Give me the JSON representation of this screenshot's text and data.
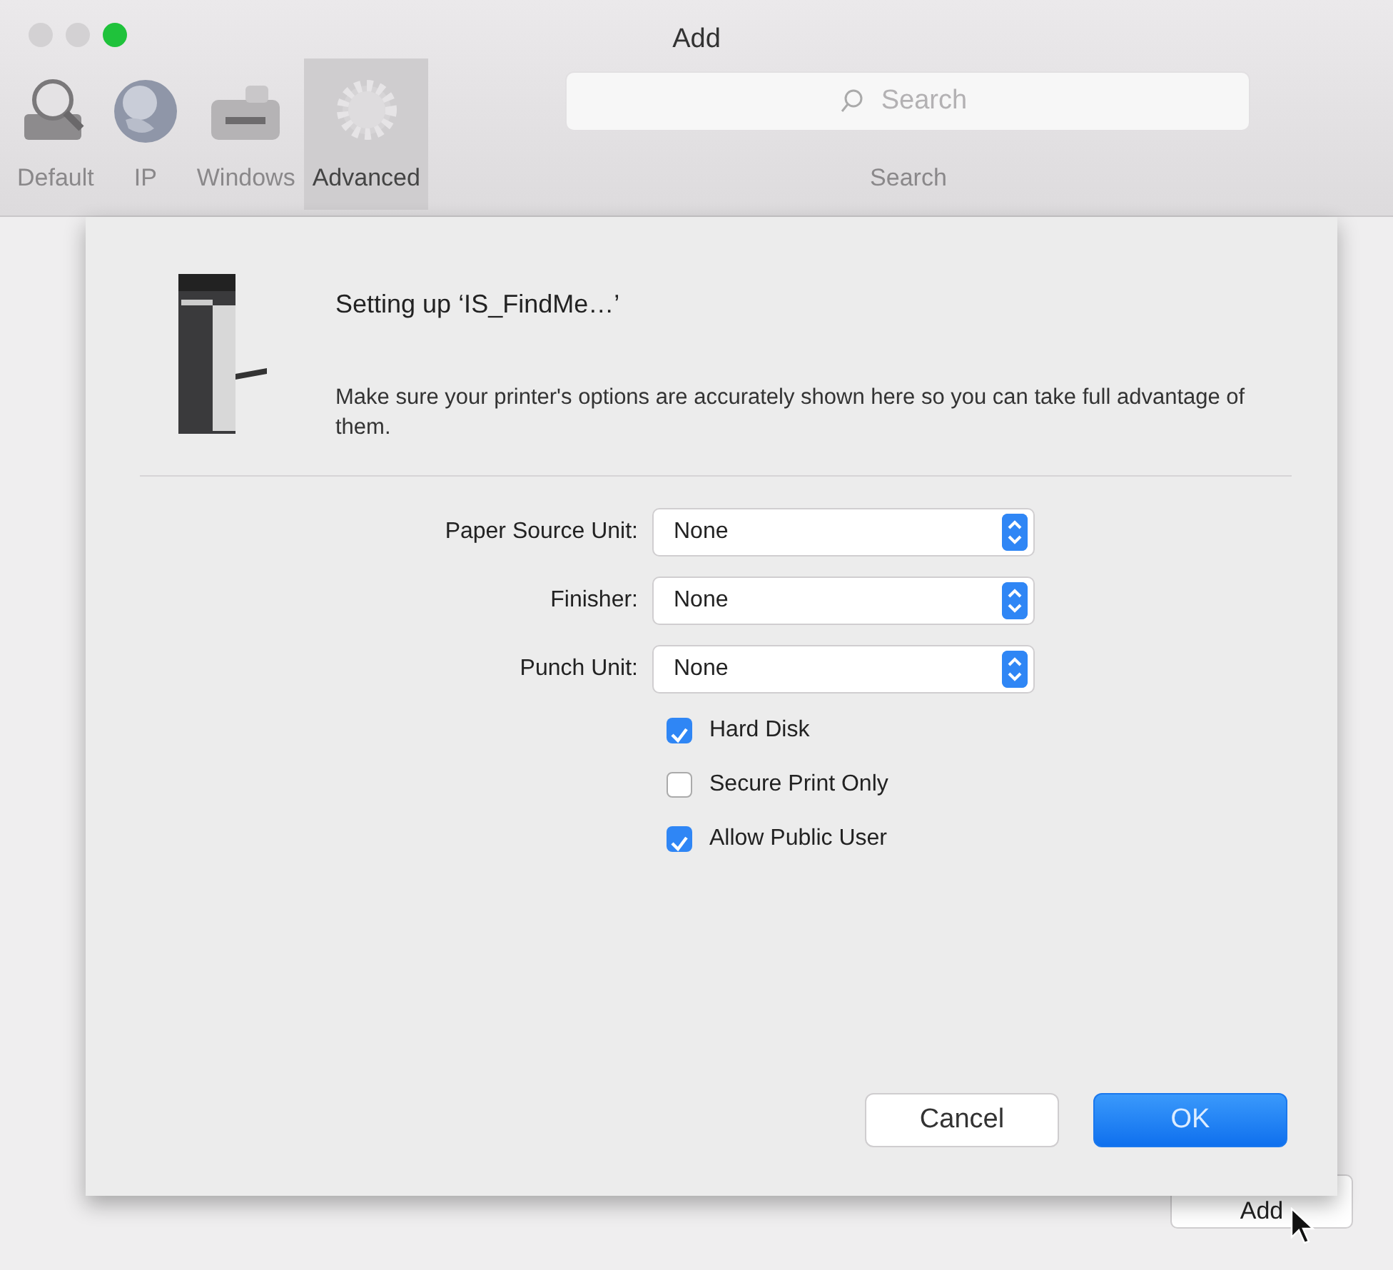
{
  "window": {
    "title": "Add",
    "controls": [
      {
        "color": "#d3d1d3"
      },
      {
        "color": "#d3d1d3"
      },
      {
        "color": "#1fc23b"
      }
    ]
  },
  "toolbar": [
    {
      "label": "Default",
      "kind": "default",
      "selected": false
    },
    {
      "label": "IP",
      "kind": "ip",
      "selected": false
    },
    {
      "label": "Windows",
      "kind": "windows",
      "selected": false
    },
    {
      "label": "Advanced",
      "kind": "advanced",
      "selected": true
    }
  ],
  "search": {
    "placeholder": "Search",
    "label": "Search"
  },
  "sheet": {
    "title": "Setting up ‘IS_FindMe…’",
    "description": "Make sure your printer's options are accurately shown here so you can take full advantage of them.",
    "options": [
      {
        "label": "Paper Source Unit:",
        "value": "None"
      },
      {
        "label": "Finisher:",
        "value": "None"
      },
      {
        "label": "Punch Unit:",
        "value": "None"
      }
    ],
    "checkboxes": [
      {
        "label": "Hard Disk",
        "checked": true
      },
      {
        "label": "Secure Print Only",
        "checked": false
      },
      {
        "label": "Allow Public User",
        "checked": true
      }
    ],
    "buttons": [
      {
        "label": "Cancel",
        "kind": "default"
      },
      {
        "label": "OK",
        "kind": "primary"
      }
    ]
  },
  "window_button": {
    "label": "Add"
  }
}
